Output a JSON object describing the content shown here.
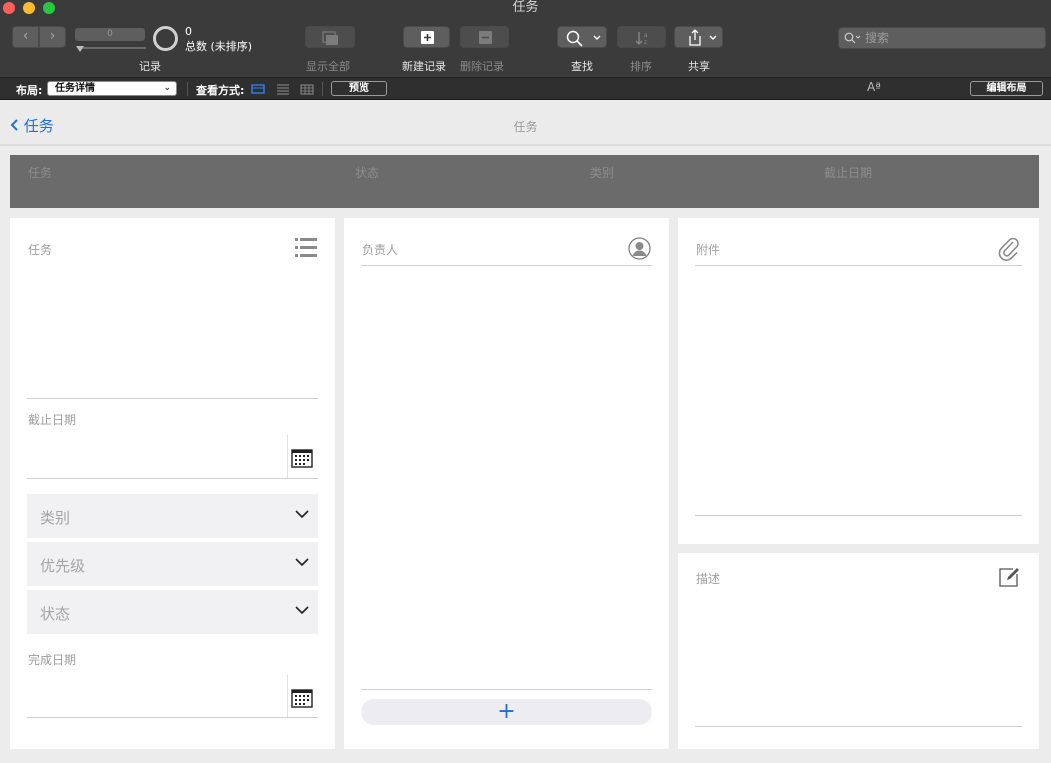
{
  "window": {
    "title": "任务"
  },
  "toolbar": {
    "record_field_value": "0",
    "total_count": "0",
    "total_label": "总数 (未排序)",
    "records_label": "记录",
    "show_all_label": "显示全部",
    "new_record_label": "新建记录",
    "delete_record_label": "删除记录",
    "find_label": "查找",
    "sort_label": "排序",
    "share_label": "共享",
    "search_placeholder": "搜索"
  },
  "layout_bar": {
    "layout_label": "布局:",
    "layout_value": "任务详情",
    "view_as_label": "查看方式:",
    "preview_label": "预览",
    "font_size_label": "Aª",
    "edit_layout_label": "编辑布局"
  },
  "header": {
    "back_label": "任务",
    "title": "任务"
  },
  "summary": {
    "columns": [
      "任务",
      "状态",
      "类别",
      "截止日期"
    ]
  },
  "left_panel": {
    "task_label": "任务",
    "due_date_label": "截止日期",
    "dropdowns": [
      "类别",
      "优先级",
      "状态"
    ],
    "completed_date_label": "完成日期"
  },
  "middle_panel": {
    "assignee_label": "负责人",
    "add_label": "+"
  },
  "right_panel": {
    "attachments_label": "附件",
    "description_label": "描述"
  }
}
